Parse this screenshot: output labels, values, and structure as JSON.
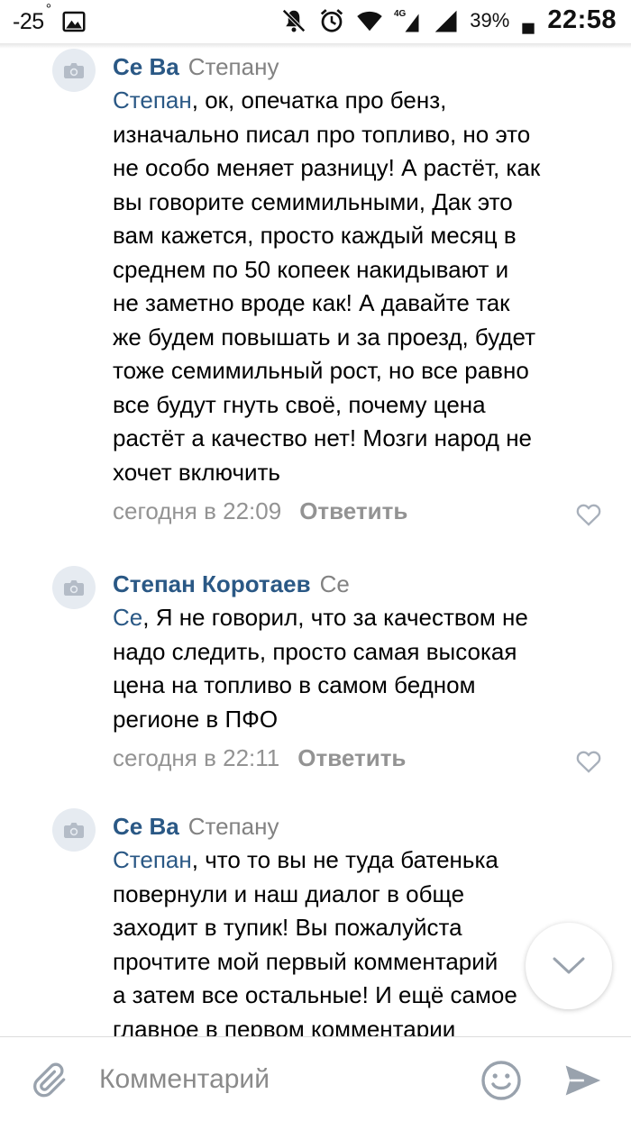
{
  "status_bar": {
    "temperature": "-25",
    "degree": "°",
    "battery_percent": "39%",
    "clock": "22:58",
    "icons": [
      "image-icon",
      "mute-icon",
      "alarm-icon",
      "wifi-icon",
      "signal-4g-icon",
      "signal-icon",
      "battery-icon"
    ]
  },
  "comments": [
    {
      "author": "Се Ва",
      "reply_to": "Степану",
      "mention": "Степан",
      "text_lines": [
        ", ок, опечатка про бенз,",
        "изначально писал про топливо, но это",
        "не особо меняет разницу! А растёт, как",
        "вы говорите семимильными, Дак это",
        "вам кажется, просто каждый месяц в",
        "среднем по 50 копеек накидывают и",
        "не заметно вроде как! А давайте так",
        "же будем повышать и за проезд, будет",
        "тоже семимильный рост, но все равно",
        "все будут гнуть своё, почему цена",
        "растёт а качество нет! Мозги народ не",
        "хочет включить"
      ],
      "time": "сегодня в 22:09",
      "reply_label": "Ответить"
    },
    {
      "author": "Степан Коротаев",
      "reply_to": "Се",
      "mention": "Се",
      "text_lines": [
        ", Я не говорил, что за качеством не",
        "надо следить, просто самая высокая",
        "цена на топливо в самом бедном",
        "регионе в ПФО"
      ],
      "time": "сегодня в 22:11",
      "reply_label": "Ответить"
    },
    {
      "author": "Се Ва",
      "reply_to": "Степану",
      "mention": "Степан",
      "text_lines": [
        ", что то вы не туда батенька",
        "повернули и наш диалог в обще",
        "заходит в тупик! Вы пожалуйста",
        "прочтите мой первый комментарий",
        "а затем все остальные! И ещё самое",
        "главное в первом комментарии"
      ]
    }
  ],
  "composer": {
    "placeholder": "Комментарий"
  },
  "colors": {
    "link": "#2a5885",
    "secondary": "#939393",
    "icon": "#b4bcc7"
  }
}
